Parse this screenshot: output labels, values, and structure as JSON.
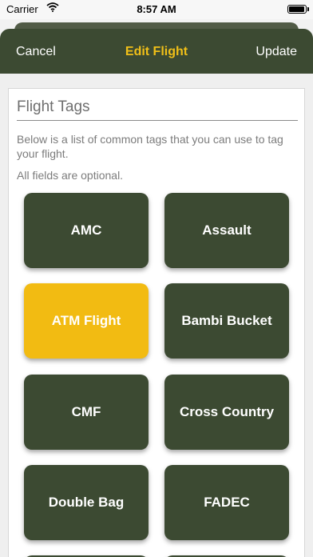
{
  "status_bar": {
    "carrier": "Carrier",
    "time": "8:57 AM"
  },
  "nav": {
    "cancel_label": "Cancel",
    "title": "Edit Flight",
    "update_label": "Update"
  },
  "section": {
    "title": "Flight Tags",
    "description": "Below is a list of common tags that you can use to tag your flight.",
    "optional_note": "All fields are optional."
  },
  "tags": [
    {
      "label": "AMC",
      "selected": false
    },
    {
      "label": "Assault",
      "selected": false
    },
    {
      "label": "ATM Flight",
      "selected": true
    },
    {
      "label": "Bambi Bucket",
      "selected": false
    },
    {
      "label": "CMF",
      "selected": false
    },
    {
      "label": "Cross Country",
      "selected": false
    },
    {
      "label": "Double Bag",
      "selected": false
    },
    {
      "label": "FADEC",
      "selected": false
    }
  ],
  "colors": {
    "brand_green": "#3c4a32",
    "accent_yellow": "#f2bb12",
    "title_yellow": "#f0bf18"
  }
}
